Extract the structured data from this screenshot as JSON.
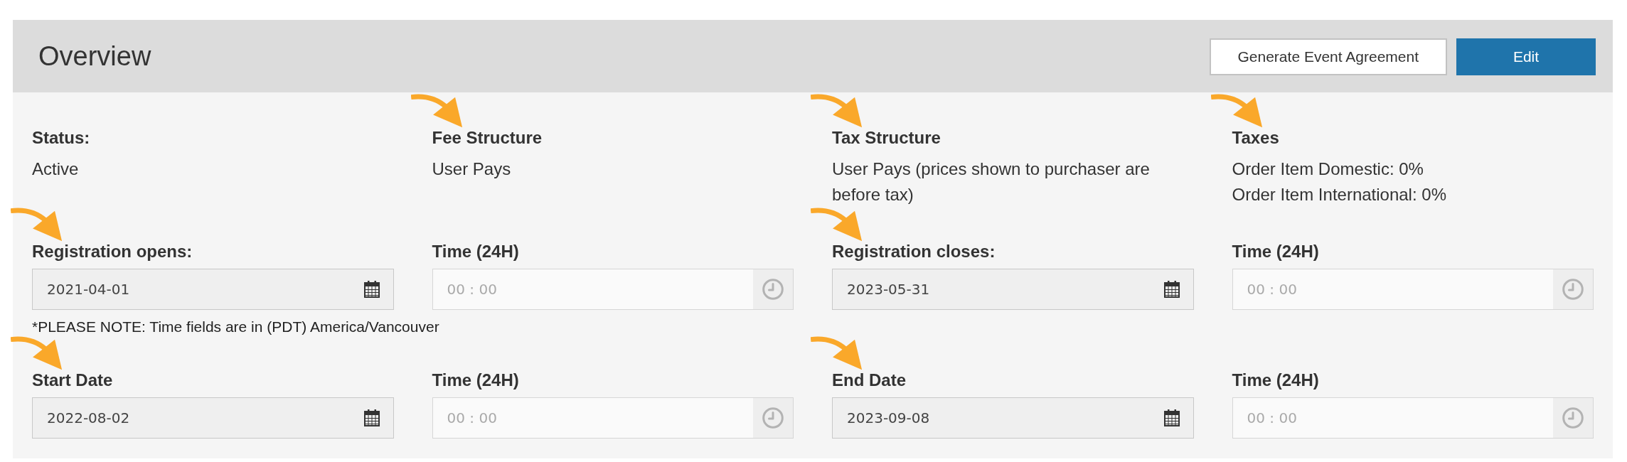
{
  "header": {
    "title": "Overview",
    "buttons": [
      {
        "label": "Generate Event Agreement",
        "kind": "outline"
      },
      {
        "label": "Edit",
        "kind": "primary"
      }
    ]
  },
  "summary": [
    {
      "label": "Status:",
      "lines": [
        "Active"
      ],
      "marked": false
    },
    {
      "label": "Fee Structure",
      "lines": [
        "User Pays"
      ],
      "marked": true
    },
    {
      "label": "Tax Structure",
      "lines": [
        "User Pays (prices shown to purchaser are before tax)"
      ],
      "marked": true
    },
    {
      "label": "Taxes",
      "lines": [
        "Order Item Domestic: 0%",
        "Order Item International: 0%"
      ],
      "marked": true
    }
  ],
  "registration": [
    {
      "label": "Registration opens:",
      "kind": "date",
      "value": "2021-04-01",
      "marked": true
    },
    {
      "label": "Time (24H)",
      "kind": "time",
      "placeholder": "00 : 00",
      "marked": false
    },
    {
      "label": "Registration closes:",
      "kind": "date",
      "value": "2023-05-31",
      "marked": true
    },
    {
      "label": "Time (24H)",
      "kind": "time",
      "placeholder": "00 : 00",
      "marked": false
    }
  ],
  "note": "*PLEASE NOTE: Time fields are in (PDT) America/Vancouver",
  "event_dates": [
    {
      "label": "Start Date",
      "kind": "date",
      "value": "2022-08-02",
      "marked": true
    },
    {
      "label": "Time (24H)",
      "kind": "time",
      "placeholder": "00 : 00",
      "marked": false
    },
    {
      "label": "End Date",
      "kind": "date",
      "value": "2023-09-08",
      "marked": true
    },
    {
      "label": "Time (24H)",
      "kind": "time",
      "placeholder": "00 : 00",
      "marked": false
    }
  ]
}
